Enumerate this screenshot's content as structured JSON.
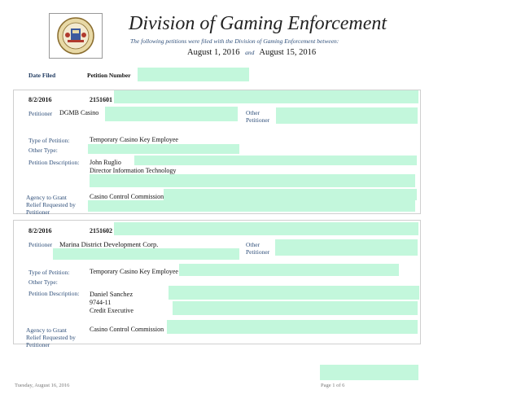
{
  "header": {
    "title": "Division of Gaming Enforcement",
    "subtitle": "The following petitions were filed with the Division of Gaming Enforcement between:",
    "start_date": "August 1, 2016",
    "and_word": "and",
    "end_date": "August 15, 2016"
  },
  "column_headers": {
    "date_filed": "Date Filed",
    "petition_number": "Petition Number"
  },
  "labels": {
    "petitioner": "Petitioner",
    "other_petitioner_1": "Other",
    "other_petitioner_2": "Petitioner",
    "type_of_petition": "Type of Petition:",
    "other_type": "Other Type:",
    "petition_description": "Petition Description:",
    "agency_1": "Agency to Grant",
    "agency_2": "Relief Requested by",
    "agency_3": "Petitioner"
  },
  "records": [
    {
      "date": "8/2/2016",
      "number": "2151601",
      "petitioner": "DGMB Casino",
      "type": "Temporary Casino Key Employee",
      "description": [
        "John Ruglio",
        "Director Information Technology"
      ],
      "agency": "Casino Control Commission"
    },
    {
      "date": "8/2/2016",
      "number": "2151602",
      "petitioner": "Marina District Development Corp.",
      "type": "Temporary Casino Key Employee",
      "description": [
        "Daniel Sanchez",
        "9744-11",
        "Credit Executive"
      ],
      "agency": "Casino Control Commission"
    }
  ],
  "footer": {
    "date": "Tuesday, August 16, 2016",
    "page": "Page 1 of 6"
  }
}
